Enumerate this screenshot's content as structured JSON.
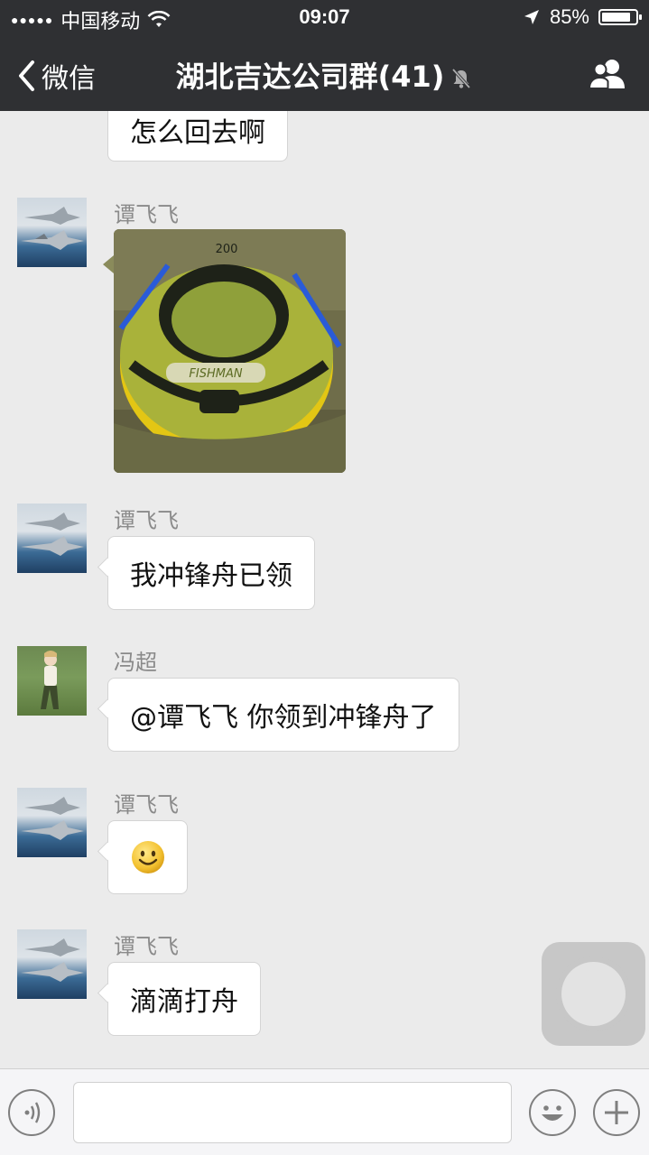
{
  "status_bar": {
    "signal_dots": "●●●●●",
    "carrier": "中国移动",
    "time": "09:07",
    "battery_percent": "85%",
    "battery_level": 0.85,
    "icons": [
      "wifi-icon",
      "location-arrow-icon",
      "battery-icon"
    ]
  },
  "nav": {
    "back_label": "微信",
    "title": "湖北吉达公司群(41)",
    "icons": [
      "back-chevron-icon",
      "mute-bell-icon",
      "group-members-icon"
    ]
  },
  "messages": [
    {
      "type": "text",
      "text": "怎么回去啊",
      "partial": true
    },
    {
      "type": "image",
      "sender": "谭飞飞",
      "avatar": "fighter-jet-avatar",
      "image_text": "FISHMAN",
      "image_text2": "200"
    },
    {
      "type": "text",
      "sender": "谭飞飞",
      "avatar": "fighter-jet-avatar",
      "text": "我冲锋舟已领"
    },
    {
      "type": "text",
      "sender": "冯超",
      "avatar": "person-outdoor-avatar",
      "text": "@谭飞飞 你领到冲锋舟了"
    },
    {
      "type": "emoji",
      "sender": "谭飞飞",
      "avatar": "fighter-jet-avatar",
      "emoji": "smile-emoji"
    },
    {
      "type": "text",
      "sender": "谭飞飞",
      "avatar": "fighter-jet-avatar",
      "text": "滴滴打舟"
    }
  ],
  "input_bar": {
    "placeholder": "",
    "icons": [
      "voice-icon",
      "emoji-icon",
      "plus-icon"
    ]
  },
  "colors": {
    "nav_bg": "#2f3033",
    "chat_bg": "#ebebeb",
    "bubble_bg": "#ffffff",
    "sender_text": "#8a8a8a"
  }
}
